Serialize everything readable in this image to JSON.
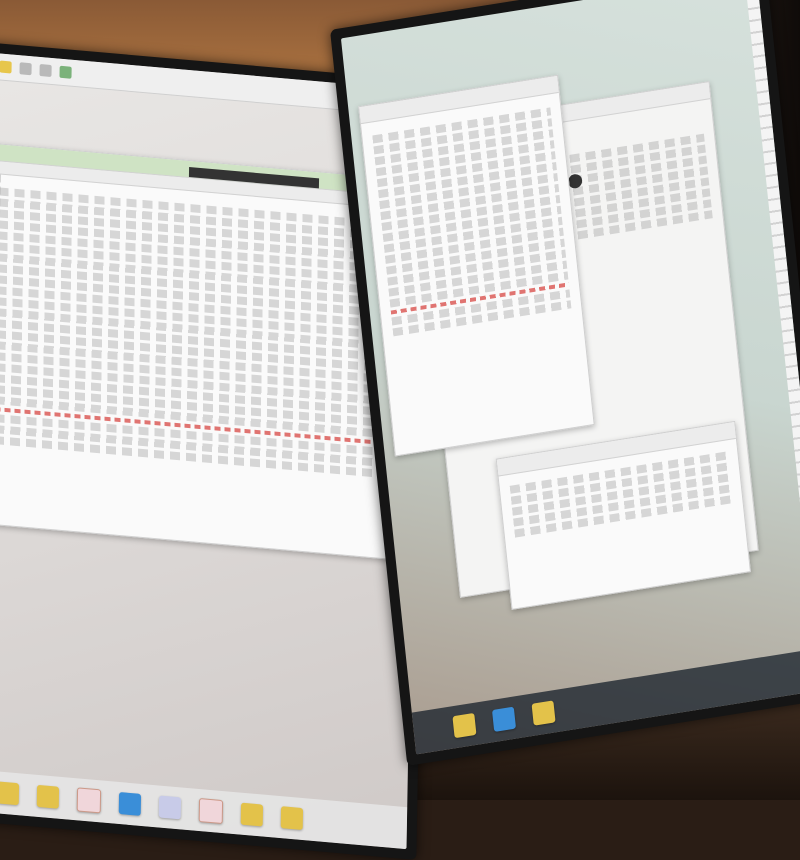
{
  "scene": {
    "description_free": true,
    "colors": {
      "wall": "#a8703f",
      "desk": "#2a1d15",
      "bezel": "#151515",
      "left_wallpaper": "#e9e7e5",
      "right_wallpaper": "#d6e1dc",
      "accent_red_rows": "#d9534f",
      "folder_icon": "#e3c24a",
      "blue_icon": "#3a8ed8"
    }
  },
  "left_monitor": {
    "toolbar_icons": [
      "folder-icon",
      "app-icon",
      "app-icon",
      "window-icon"
    ],
    "taskbar_icons": [
      "folder-icon",
      "folder-icon",
      "pink-app-icon",
      "blue-app-icon",
      "grid-app-icon",
      "pink-app-icon",
      "folder-icon",
      "folder-icon"
    ]
  },
  "right_monitor": {
    "taskbar_icons": [
      "folder-icon",
      "blue-app-icon",
      "folder-icon"
    ]
  }
}
